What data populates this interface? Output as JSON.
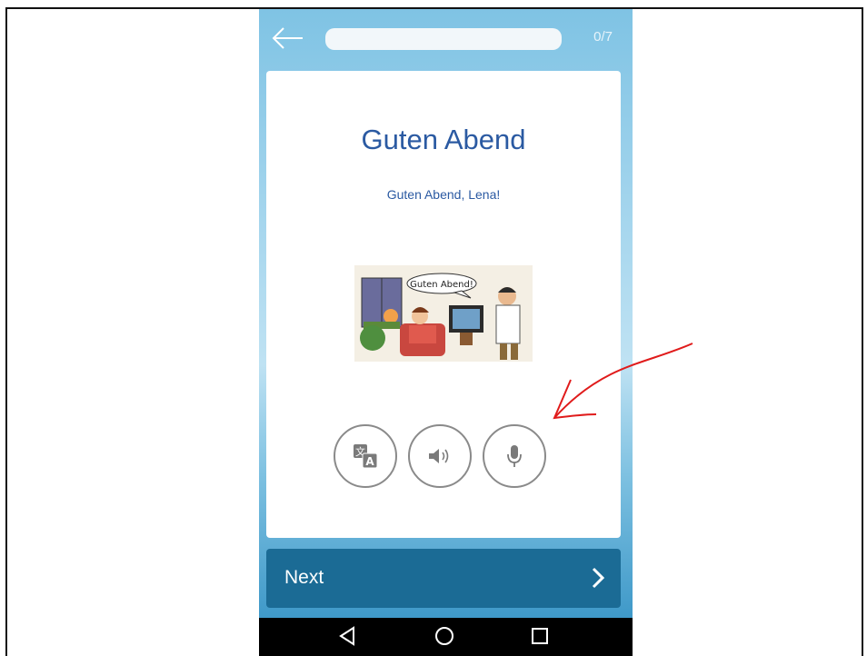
{
  "header": {
    "back_icon": "arrow-left-icon",
    "progress_fraction": 0.0,
    "counter": "0/7"
  },
  "card": {
    "title": "Guten Abend",
    "subtitle": "Guten Abend, Lena!",
    "illustration": {
      "speech_bubble_text": "Guten Abend!"
    },
    "actions": [
      {
        "icon": "translate-icon"
      },
      {
        "icon": "speaker-icon"
      },
      {
        "icon": "microphone-icon"
      }
    ]
  },
  "footer": {
    "next_label": "Next",
    "next_icon": "chevron-right-icon"
  },
  "system_nav": {
    "back": "back-triangle-icon",
    "home": "home-circle-icon",
    "recents": "recents-square-icon"
  },
  "colors": {
    "accent": "#2b5aa2",
    "next_bar": "#1b6b95",
    "annotation_arrow": "#e01b1b"
  }
}
